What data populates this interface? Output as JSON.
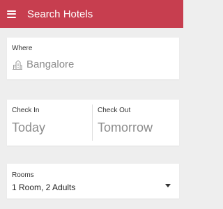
{
  "appbar": {
    "title": "Search Hotels",
    "menu_icon": "hamburger-menu-icon",
    "background": "#c73e4f"
  },
  "where": {
    "label": "Where",
    "value": "Bangalore",
    "icon": "city-icon"
  },
  "dates": {
    "check_in_label": "Check In",
    "check_in_value": "Today",
    "check_out_label": "Check Out",
    "check_out_value": "Tomorrow"
  },
  "rooms": {
    "label": "Rooms",
    "value": "1 Room, 2 Adults",
    "icon": "dropdown-arrow-icon"
  }
}
